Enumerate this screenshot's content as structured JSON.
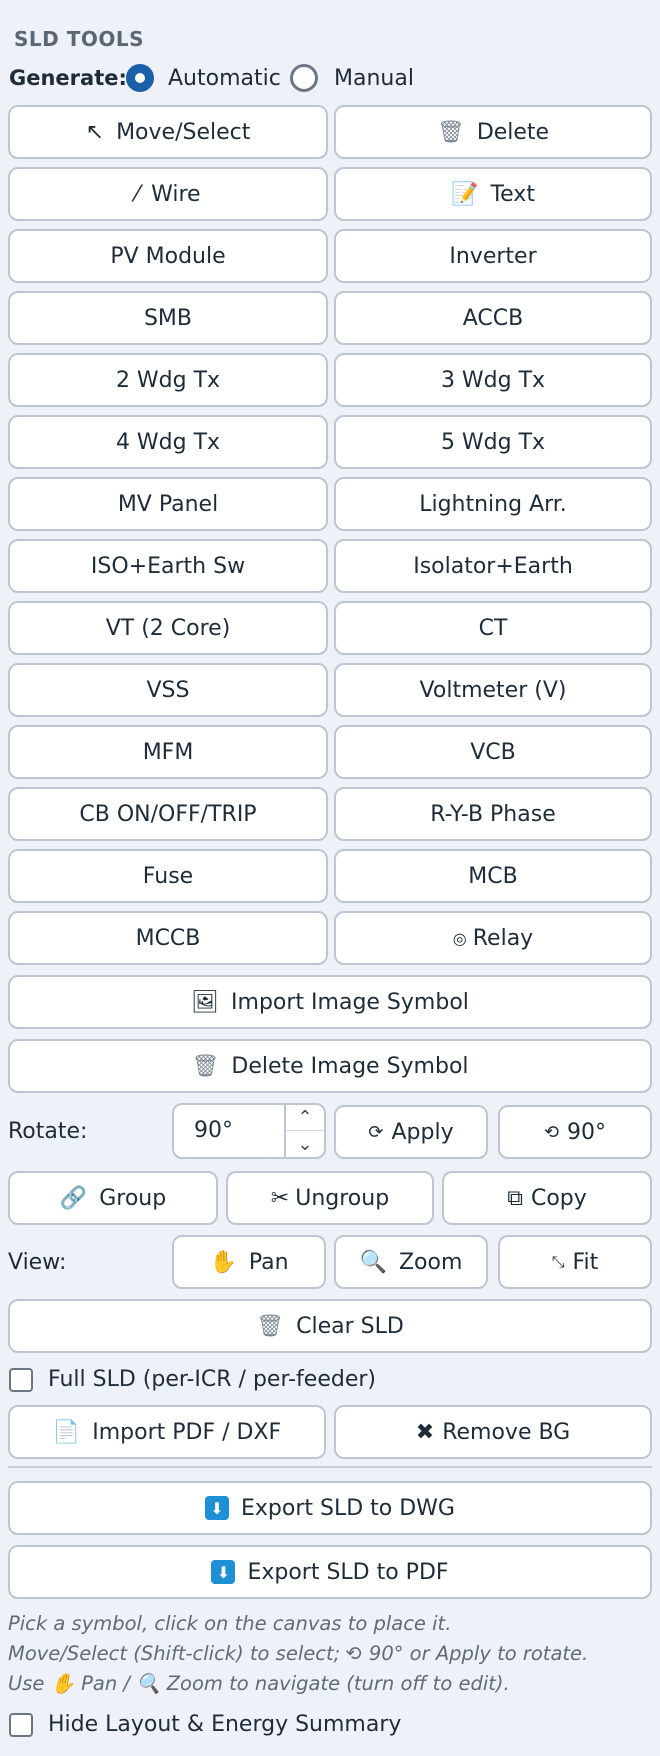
{
  "header": {
    "title": "SLD TOOLS"
  },
  "generate": {
    "label": "Generate:",
    "option_auto": "Automatic",
    "option_manual": "Manual",
    "selected": "Automatic"
  },
  "tools": {
    "move_select": "Move/Select",
    "delete": "Delete",
    "wire": "Wire",
    "text": "Text",
    "pv_module": "PV Module",
    "inverter": "Inverter",
    "smb": "SMB",
    "accb": "ACCB",
    "wdg2": "2 Wdg Tx",
    "wdg3": "3 Wdg Tx",
    "wdg4": "4 Wdg Tx",
    "wdg5": "5 Wdg Tx",
    "mv_panel": "MV Panel",
    "lightning": "Lightning Arr.",
    "iso_earth_sw": "ISO+Earth Sw",
    "isolator_earth": "Isolator+Earth",
    "vt": "VT (2 Core)",
    "ct": "CT",
    "vss": "VSS",
    "voltmeter": "Voltmeter (V)",
    "mfm": "MFM",
    "vcb": "VCB",
    "cb": "CB ON/OFF/TRIP",
    "ryb": "R-Y-B Phase",
    "fuse": "Fuse",
    "mcb": "MCB",
    "mccb": "MCCB",
    "relay": "Relay",
    "import_image": "Import Image Symbol",
    "delete_image": "Delete Image Symbol"
  },
  "rotate": {
    "label": "Rotate:",
    "value": "90°",
    "apply": "Apply",
    "rotate90": "90°"
  },
  "group": {
    "group": "Group",
    "ungroup": "Ungroup",
    "copy": "Copy"
  },
  "view": {
    "label": "View:",
    "pan": "Pan",
    "zoom": "Zoom",
    "fit": "Fit"
  },
  "actions": {
    "clear": "Clear SLD",
    "full_sld": "Full SLD (per-ICR / per-feeder)",
    "import_pdf": "Import PDF / DXF",
    "remove_bg": "Remove BG",
    "export_dwg": "Export SLD to DWG",
    "export_pdf": "Export SLD to PDF"
  },
  "help": {
    "line1": "Pick a symbol, click on the canvas to place it.",
    "line2": "Move/Select (Shift-click) to select; ⟲ 90° or Apply to rotate.",
    "line3a": "Use ",
    "line3_pan": "Pan",
    "line3_sep": " / ",
    "line3_zoom": "Zoom",
    "line3b": " to navigate (turn off to edit)."
  },
  "footer": {
    "hide_summary": "Hide Layout & Energy Summary"
  },
  "colors": {
    "accent": "#1a5fa8",
    "background": "#eef1f7",
    "border": "#bcc6d3"
  }
}
